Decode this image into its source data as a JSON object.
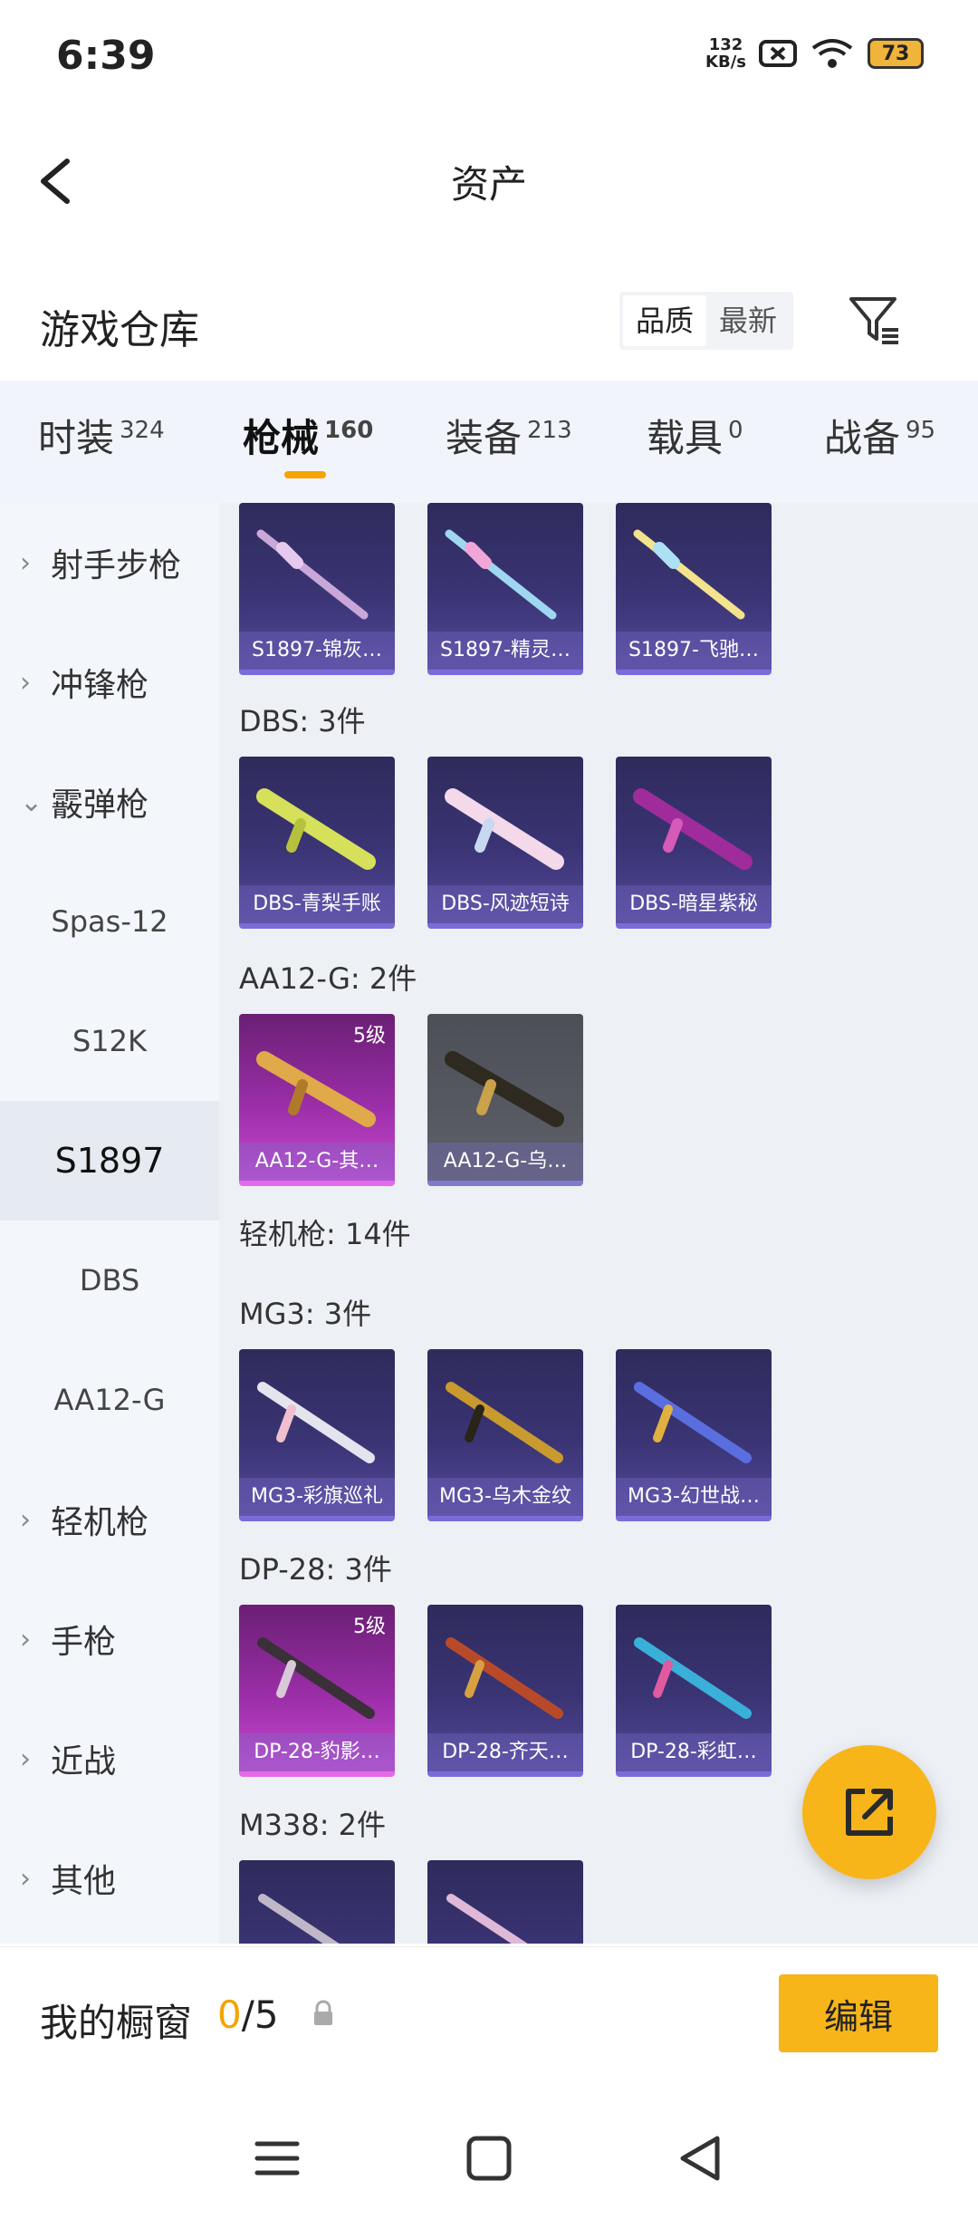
{
  "status_bar": {
    "time": "6:39",
    "net_speed_value": "132",
    "net_speed_unit": "KB/s",
    "battery": "73"
  },
  "header": {
    "title": "资产"
  },
  "section": {
    "title": "游戏仓库",
    "sort_options": [
      "品质",
      "最新"
    ]
  },
  "tabs": [
    {
      "label": "时装",
      "count": "324"
    },
    {
      "label": "枪械",
      "count": "160"
    },
    {
      "label": "装备",
      "count": "213"
    },
    {
      "label": "载具",
      "count": "0"
    },
    {
      "label": "战备",
      "count": "95"
    }
  ],
  "sidebar": [
    {
      "label": "射手步枪"
    },
    {
      "label": "冲锋枪"
    },
    {
      "label": "霰弹枪"
    },
    {
      "label": "Spas-12"
    },
    {
      "label": "S12K"
    },
    {
      "label": "S1897"
    },
    {
      "label": "DBS"
    },
    {
      "label": "AA12-G"
    },
    {
      "label": "轻机枪"
    },
    {
      "label": "手枪"
    },
    {
      "label": "近战"
    },
    {
      "label": "其他"
    }
  ],
  "groups": {
    "s1897_cards": [
      "S1897-锦灰…",
      "S1897-精灵…",
      "S1897-飞驰…"
    ],
    "dbs_title": "DBS: 3件",
    "dbs_cards": [
      "DBS-青梨手账",
      "DBS-风迹短诗",
      "DBS-暗星紫秘"
    ],
    "aa12_title": "AA12-G: 2件",
    "aa12_cards": [
      "AA12-G-其…",
      "AA12-G-乌…"
    ],
    "aa12_level": "5级",
    "lmg_title": "轻机枪: 14件",
    "mg3_title": "MG3: 3件",
    "mg3_cards": [
      "MG3-彩旗巡礼",
      "MG3-乌木金纹",
      "MG3-幻世战…"
    ],
    "dp28_title": "DP-28: 3件",
    "dp28_cards": [
      "DP-28-豹影…",
      "DP-28-齐天…",
      "DP-28-彩虹…"
    ],
    "dp28_level": "5级",
    "m338_title": "M338: 2件"
  },
  "bottom_bar": {
    "label": "我的橱窗",
    "count_current": "0",
    "count_total": "/5",
    "edit_label": "编辑"
  }
}
